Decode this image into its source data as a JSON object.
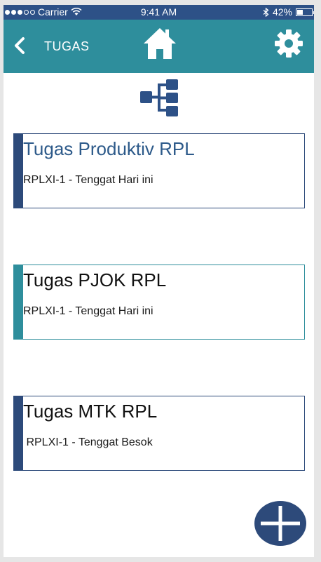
{
  "status_bar": {
    "carrier": "Carrier",
    "time": "9:41 AM",
    "battery": "42%",
    "battery_level": 0.42
  },
  "app_bar": {
    "back_icon": "chevron-left-icon",
    "title": "TUGAS",
    "home_icon": "home-icon",
    "settings_icon": "gear-icon"
  },
  "header_icon": "tree-structure-icon",
  "tasks": [
    {
      "title": "Tugas Produktiv RPL",
      "subtitle": "RPLXI-1 - Tenggat Hari ini",
      "accent": "#2d4a7a",
      "title_color": "#2d5a8a",
      "border": "#2d4a7a"
    },
    {
      "title": "Tugas PJOK RPL",
      "subtitle": "RPLXI-1 - Tenggat Hari ini",
      "accent": "#2e8e9c",
      "title_color": "#111111",
      "border": "#2e8e9c"
    },
    {
      "title": "Tugas MTK RPL",
      "subtitle": " RPLXI-1 - Tenggat Besok",
      "accent": "#2d4a7a",
      "title_color": "#111111",
      "border": "#2d4a7a"
    }
  ],
  "fab_icon": "plus-icon",
  "colors": {
    "status_bar": "#2d5187",
    "app_bar": "#2e8e9c",
    "primary": "#2d4a7a"
  }
}
